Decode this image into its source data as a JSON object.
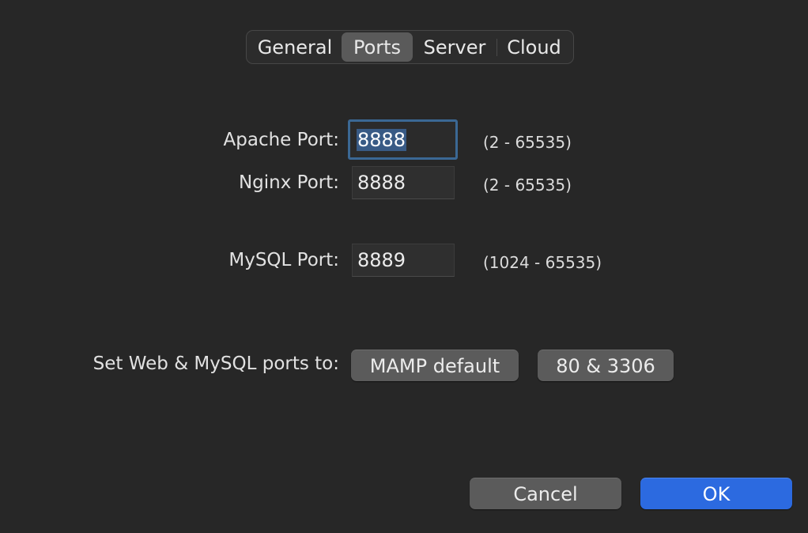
{
  "tabs": [
    {
      "label": "General",
      "selected": false
    },
    {
      "label": "Ports",
      "selected": true
    },
    {
      "label": "Server",
      "selected": false
    },
    {
      "label": "Cloud",
      "selected": false
    }
  ],
  "ports": {
    "apache": {
      "label": "Apache Port:",
      "value": "8888",
      "range": "(2 - 65535)"
    },
    "nginx": {
      "label": "Nginx Port:",
      "value": "8888",
      "range": "(2 - 65535)"
    },
    "mysql": {
      "label": "MySQL Port:",
      "value": "8889",
      "range": "(1024 - 65535)"
    }
  },
  "presets": {
    "label": "Set Web & MySQL ports to:",
    "mamp_default": "MAMP default",
    "standard": "80 & 3306"
  },
  "actions": {
    "cancel": "Cancel",
    "ok": "OK"
  },
  "colors": {
    "accent": "#2c6ae0",
    "focus_ring": "#3b6894",
    "selected_tab": "#5a5a5a"
  }
}
